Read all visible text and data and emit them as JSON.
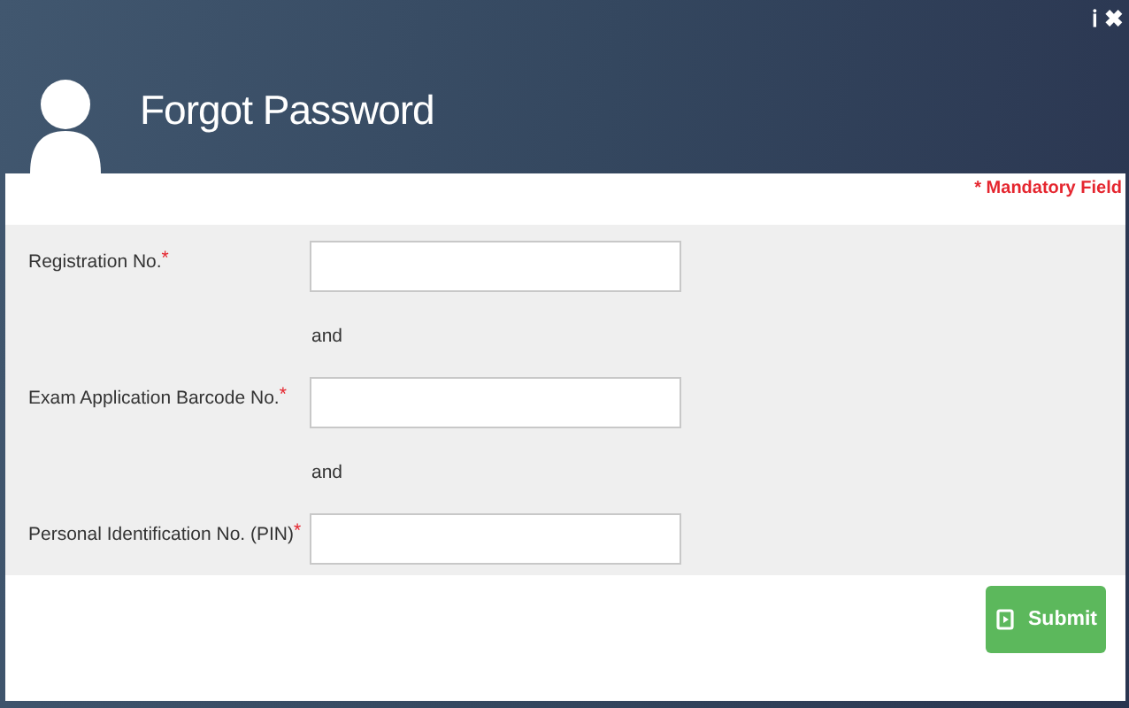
{
  "header": {
    "title": "Forgot Password",
    "info_icon": "ℹ",
    "close_icon": "✖"
  },
  "mandatory_note": "* Mandatory Field",
  "fields": [
    {
      "label": "Registration No.",
      "marker": "*"
    },
    {
      "kind": "separator",
      "text": "and"
    },
    {
      "label": "Exam Application Barcode No.",
      "marker": "*"
    },
    {
      "kind": "separator",
      "text": "and"
    },
    {
      "label": "Personal Identification No. (PIN)",
      "marker": "*"
    }
  ],
  "submit": {
    "label": "Submit"
  }
}
